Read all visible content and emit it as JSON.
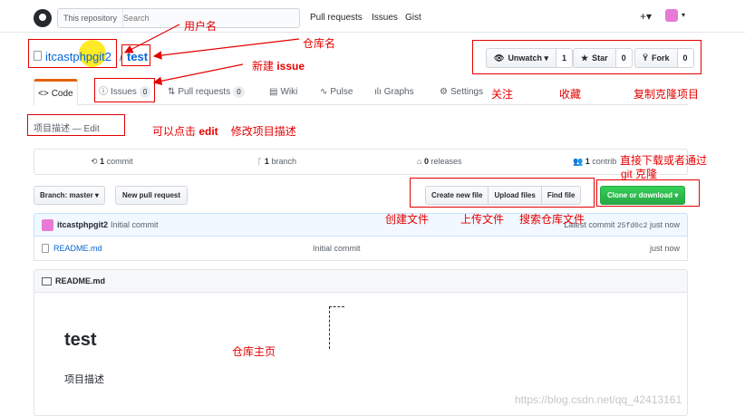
{
  "header": {
    "search_scope": "This repository",
    "search_placeholder": "Search",
    "nav": [
      "Pull requests",
      "Issues",
      "Gist"
    ],
    "plus_menu": "+▾",
    "avatar_caret": "▾"
  },
  "repo": {
    "owner": "itcastphpgit2",
    "separator": "/",
    "name": "test"
  },
  "actions": {
    "watch_label": "Unwatch ▾",
    "watch_count": "1",
    "star_label": "Star",
    "star_count": "0",
    "fork_label": "Fork",
    "fork_count": "0"
  },
  "tabs": [
    {
      "label": "Code",
      "icon": "code-icon"
    },
    {
      "label": "Issues",
      "count": "0",
      "icon": "issue-icon"
    },
    {
      "label": "Pull requests",
      "count": "0",
      "icon": "pull-request-icon"
    },
    {
      "label": "Wiki",
      "icon": "wiki-icon"
    },
    {
      "label": "Pulse",
      "icon": "pulse-icon"
    },
    {
      "label": "Graphs",
      "icon": "graph-icon"
    },
    {
      "label": "Settings",
      "icon": "gear-icon"
    }
  ],
  "description": {
    "text": "项目描述",
    "edit": "— Edit"
  },
  "numbers": {
    "commits_count": "1",
    "commits_label": " commit",
    "branches_count": "1",
    "branches_label": " branch",
    "releases_count": "0",
    "releases_label": " releases",
    "contributors_count": "1",
    "contributors_label": " contrib"
  },
  "file_nav": {
    "branch_button": "Branch: master ▾",
    "new_pr_button": "New pull request",
    "create_file": "Create new file",
    "upload_files": "Upload files",
    "find_file": "Find file",
    "clone": "Clone or download ▾"
  },
  "commit": {
    "author": "itcastphpgit2",
    "message": "Initial commit",
    "latest_label": "Latest commit",
    "sha": "25fd0c2",
    "age": "just now"
  },
  "files": [
    {
      "name": "README.md",
      "message": "Initial commit",
      "age": "just now"
    }
  ],
  "readme": {
    "title": "README.md",
    "heading": "test",
    "body": "项目描述"
  },
  "annotations": {
    "username": "用户名",
    "repo_name": "仓库名",
    "new_issue": "新建 ",
    "new_issue_bold": "issue",
    "watch": "关注",
    "star": "收藏",
    "fork": "复制克隆项目",
    "click_edit": "可以点击 ",
    "click_edit_bold": "edit",
    "click_edit_tail": "修改项目描述",
    "download_line1": "直接下载或者通过",
    "download_line2": "git  克隆",
    "create_file": "创建文件",
    "upload_file": "上传文件",
    "search_file": "搜索仓库文件",
    "homepage": "仓库主页"
  },
  "watermark": "https://blog.csdn.net/qq_42413161",
  "colors": {
    "link": "#0366d6",
    "annotation": "#e60000",
    "selected_tab_accent": "#e36209",
    "clone_button": "#28a745"
  }
}
